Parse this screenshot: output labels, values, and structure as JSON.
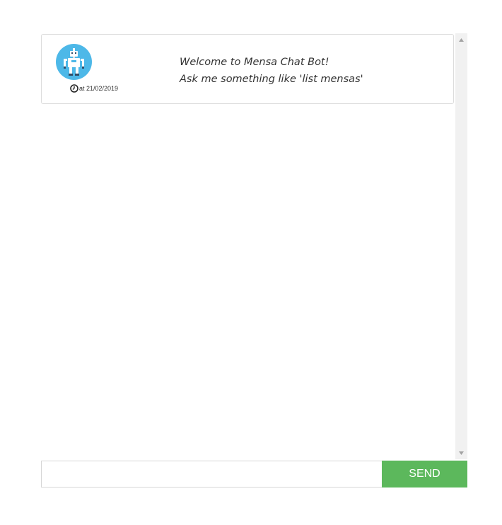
{
  "chat": {
    "messages": [
      {
        "sender_avatar": "robot-avatar",
        "timestamp": "at 21/02/2019",
        "lines": [
          "Welcome to Mensa Chat Bot!",
          "Ask me something like 'list mensas'"
        ]
      }
    ]
  },
  "input": {
    "value": "",
    "placeholder": ""
  },
  "send_button": {
    "label": "SEND",
    "color": "#5cb85c"
  },
  "colors": {
    "avatar_background": "#4db8e8"
  },
  "icons": {
    "clock": "clock-icon",
    "scroll_up": "scroll-up-arrow-icon",
    "scroll_down": "scroll-down-arrow-icon"
  }
}
